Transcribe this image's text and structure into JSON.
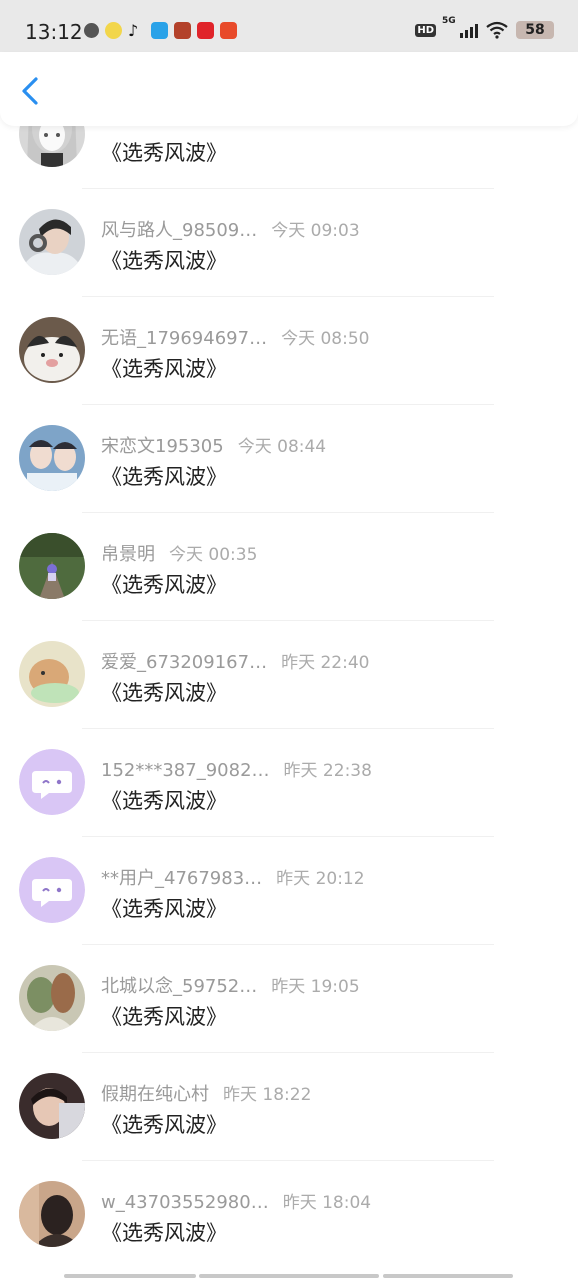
{
  "status_bar": {
    "time": "13:12",
    "network": "5G",
    "battery": "58",
    "hd_label": "HD"
  },
  "header": {
    "back_icon": "chevron-left-icon"
  },
  "messages": [
    {
      "name": "",
      "time": "",
      "text": "《选秀风波》"
    },
    {
      "name": "风与路人_98509…",
      "time": "今天 09:03",
      "text": "《选秀风波》"
    },
    {
      "name": "无语_179694697…",
      "time": "今天 08:50",
      "text": "《选秀风波》"
    },
    {
      "name": "宋恋文195305",
      "time": "今天 08:44",
      "text": "《选秀风波》"
    },
    {
      "name": "帛景明",
      "time": "今天 00:35",
      "text": "《选秀风波》"
    },
    {
      "name": "爱爱_673209167…",
      "time": "昨天 22:40",
      "text": "《选秀风波》"
    },
    {
      "name": "152***387_9082…",
      "time": "昨天 22:38",
      "text": "《选秀风波》"
    },
    {
      "name": "**用户_4767983…",
      "time": "昨天 20:12",
      "text": "《选秀风波》"
    },
    {
      "name": "北城以念_59752…",
      "time": "昨天 19:05",
      "text": "《选秀风波》"
    },
    {
      "name": "假期在纯心村",
      "time": "昨天 18:22",
      "text": "《选秀风波》"
    },
    {
      "name": "w_43703552980…",
      "time": "昨天 18:04",
      "text": "《选秀风波》"
    }
  ],
  "colors": {
    "accent": "#2a8ff0",
    "name_text": "#9a9a9a",
    "time_text": "#ababab",
    "default_avatar": "#d9c6f5"
  }
}
